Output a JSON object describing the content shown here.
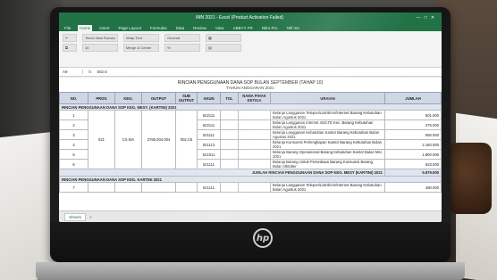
{
  "window": {
    "title": "IMN 2021 - Excel (Product Activation Failed)",
    "controls": [
      "—",
      "□",
      "✕"
    ]
  },
  "menu": [
    "File",
    "Home",
    "Insert",
    "Page Layout",
    "Formulas",
    "Data",
    "Review",
    "View",
    "ABBYY FR",
    "Nitro Pro",
    "Tell me"
  ],
  "ribbon": {
    "font_name": "Times New Roman",
    "font_size": "10",
    "wrap_text": "Wrap Text",
    "merge": "Merge & Center",
    "number_format": "General"
  },
  "formula_bar": {
    "cell": "A9",
    "fx": "fx",
    "value": "502.6"
  },
  "columns": [
    "A",
    "B",
    "C",
    "D",
    "E",
    "F",
    "G",
    "H",
    "I",
    "J"
  ],
  "sheet": {
    "heading": "RINCIAN PENGGUNAAN DANA SOP BULAN SEPTEMBER (TAHAP 10)",
    "subheading": "TAHUN ANGGARAN 2021",
    "headers": [
      "NO.",
      "PROG",
      "KEG.",
      "OUTPUT",
      "SUB OUTPUT",
      "AKUN",
      "TGL",
      "NAMA PIHAK KETIGA",
      "URAIAN",
      "JUMLAH"
    ],
    "section1": "RINCIAN PENGGUNAAN DANA SOP KEG. MESY. (KARTINI) 2021",
    "codes": {
      "prog": "021",
      "keg": "CX.WA",
      "output": "2785.004.004",
      "sub_output": "002.C5"
    },
    "rows": [
      {
        "no": "1",
        "akun": "522111",
        "uraian": "Belanja Langganan Telepon/Listrik/Air/Internet Barang Kebutuhan Bulan Agustus 2021",
        "jumlah": "501.000"
      },
      {
        "no": "2",
        "akun": "522111",
        "uraian": "Belanja Langganan Internet 4G/LTE Kec. Barang Kebutuhan Bulan Agustus 2021",
        "jumlah": "275.000"
      },
      {
        "no": "3",
        "akun": "521111",
        "uraian": "Belanja Langganan Kebutuhan Kantor Barang Kebutuhan Bulan Agustus 2021",
        "jumlah": "650.000"
      },
      {
        "no": "4",
        "akun": "521113",
        "uraian": "Belanja Konsumsi Perlengkapan Kantor Barang Kebutuhan Bulan 2021",
        "jumlah": "2.160.000"
      },
      {
        "no": "5",
        "akun": "521811",
        "uraian": "Belanja Barang Operasional Barang Kebutuhan Kantor Bulan Mei 2021",
        "jumlah": "1.800.000"
      },
      {
        "no": "6",
        "akun": "521111",
        "uraian": "Belanja Barang Untuk Persediaan Barang Konsumsi Barang Bulan Oktober",
        "jumlah": "623.000"
      }
    ],
    "total_label": "JUMLAH RINCIAN PENGGUNAAN DANA SOP KEG. MESY (KARTINI) 2021",
    "total_value": "5.979.000",
    "section2": "RINCIAN PENGGUNAAN DANA SOP KEG. KARTINI 2021",
    "row7": {
      "no": "7",
      "akun": "521111",
      "uraian": "Belanja Langganan Telepon/Listrik/Air/Internet Barang Kebutuhan Bulan Agustus 2021",
      "jumlah": "480.000"
    }
  },
  "sheet_tabs": {
    "tab": "Sheet1",
    "add": "+"
  },
  "logo": "hp"
}
